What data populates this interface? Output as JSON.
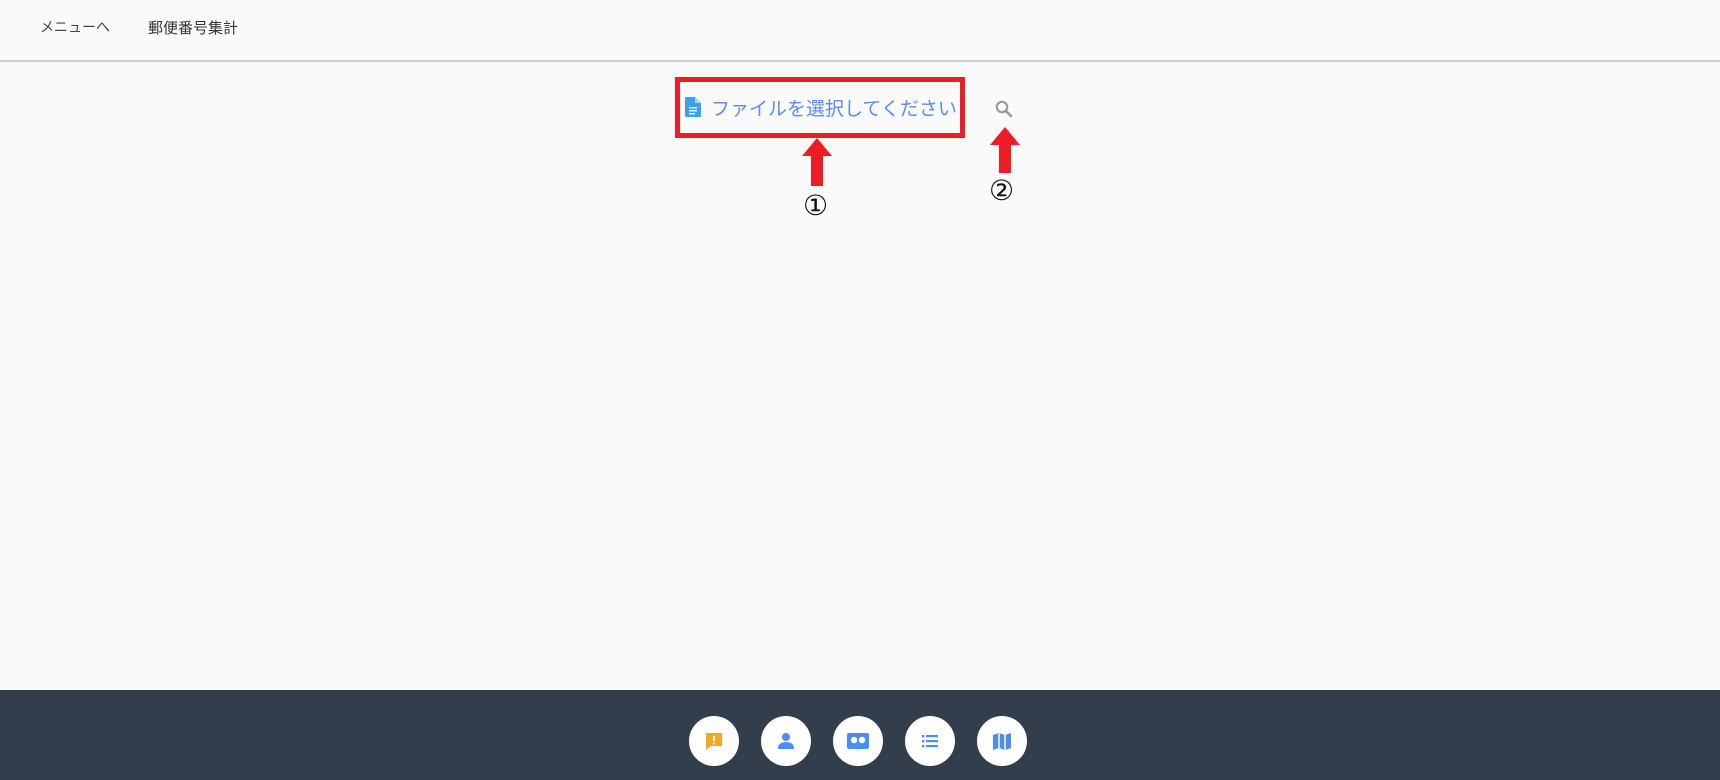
{
  "topbar": {
    "menu_link": "メニューへ",
    "page_title": "郵便番号集計"
  },
  "main": {
    "file_select_label": "ファイルを選択してください",
    "markers": [
      "①",
      "②"
    ]
  },
  "colors": {
    "highlight": "#ee1c25",
    "link_blue": "#5b8def",
    "bottom_bar": "#323e4b",
    "accent_orange": "#f5a623",
    "icon_blue": "#4a8ef0"
  },
  "bottom_nav": {
    "icons": [
      "alert-message-icon",
      "person-icon",
      "id-card-icon",
      "list-icon",
      "map-icon"
    ]
  }
}
